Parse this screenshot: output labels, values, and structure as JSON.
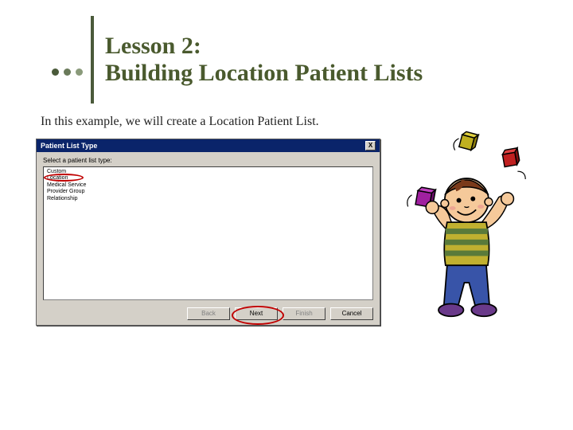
{
  "title_line1": "Lesson 2:",
  "title_line2": "Building Location Patient Lists",
  "intro": "In this example, we will create a Location Patient List.",
  "dialog": {
    "title": "Patient List Type",
    "close": "X",
    "prompt": "Select a patient list type:",
    "items": [
      "Custom",
      "Location",
      "Medical Service",
      "Provider Group",
      "Relationship"
    ],
    "buttons": {
      "back": "Back",
      "next": "Next",
      "finish": "Finish",
      "cancel": "Cancel"
    }
  },
  "highlighted_item_index": 1,
  "highlighted_button": "next"
}
